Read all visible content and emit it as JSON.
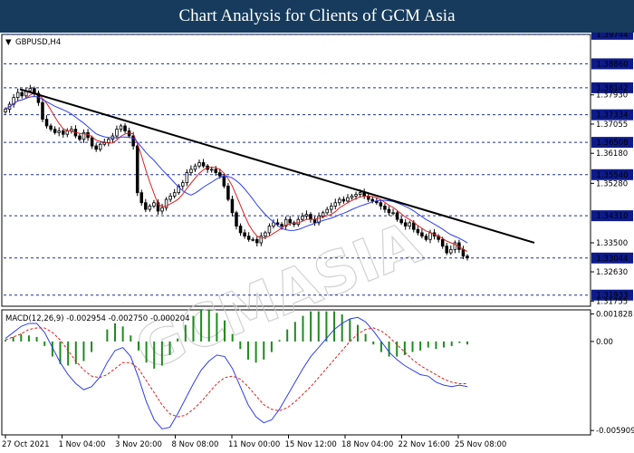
{
  "header": {
    "title": "Chart Analysis for Clients of GCM Asia"
  },
  "watermark": {
    "text": "GCMASIA"
  },
  "chart_data": [
    {
      "type": "candlestick",
      "symbol_label": "GBPUSD,H4",
      "ylim": [
        1.316,
        1.3974
      ],
      "y_tick_labels": [
        {
          "value": 1.3793,
          "label": "1.37930"
        },
        {
          "value": 1.37055,
          "label": "1.37055"
        },
        {
          "value": 1.3618,
          "label": "1.36180"
        },
        {
          "value": 1.3528,
          "label": "1.35280"
        },
        {
          "value": 1.335,
          "label": "1.33500"
        },
        {
          "value": 1.3263,
          "label": "1.32630"
        },
        {
          "value": 1.31755,
          "label": "1.31755"
        }
      ],
      "horizontal_levels": [
        {
          "value": 1.39744,
          "label": "1.39744"
        },
        {
          "value": 1.3886,
          "label": "1.38860"
        },
        {
          "value": 1.38142,
          "label": "1.38142"
        },
        {
          "value": 1.37334,
          "label": "1.37334"
        },
        {
          "value": 1.36508,
          "label": "1.36508"
        },
        {
          "value": 1.3554,
          "label": "1.35540"
        },
        {
          "value": 1.3431,
          "label": "1.34310"
        },
        {
          "value": 1.33044,
          "label": "1.33044"
        },
        {
          "value": 1.31933,
          "label": "1.31933"
        }
      ],
      "trendline": {
        "from": {
          "bar": 5,
          "price": 1.381
        },
        "to": {
          "bar": 146,
          "price": 1.335
        }
      },
      "close_prices": [
        1.375,
        1.3765,
        1.3785,
        1.38,
        1.379,
        1.3805,
        1.3812,
        1.3798,
        1.377,
        1.372,
        1.37,
        1.369,
        1.368,
        1.3685,
        1.3675,
        1.3685,
        1.369,
        1.367,
        1.366,
        1.368,
        1.3665,
        1.364,
        1.363,
        1.3645,
        1.365,
        1.366,
        1.367,
        1.369,
        1.37,
        1.3685,
        1.367,
        1.364,
        1.35,
        1.347,
        1.345,
        1.346,
        1.347,
        1.3445,
        1.3455,
        1.348,
        1.349,
        1.35,
        1.352,
        1.353,
        1.356,
        1.357,
        1.358,
        1.359,
        1.358,
        1.357,
        1.357,
        1.356,
        1.355,
        1.352,
        1.348,
        1.344,
        1.34,
        1.338,
        1.337,
        1.336,
        1.336,
        1.335,
        1.337,
        1.338,
        1.34,
        1.341,
        1.3405,
        1.34,
        1.342,
        1.341,
        1.3405,
        1.342,
        1.343,
        1.3435,
        1.342,
        1.341,
        1.343,
        1.344,
        1.345,
        1.346,
        1.347,
        1.348,
        1.3475,
        1.3485,
        1.349,
        1.3495,
        1.35,
        1.349,
        1.348,
        1.3475,
        1.347,
        1.346,
        1.345,
        1.344,
        1.344,
        1.342,
        1.341,
        1.34,
        1.341,
        1.339,
        1.338,
        1.337,
        1.336,
        1.338,
        1.337,
        1.336,
        1.334,
        1.332,
        1.333,
        1.335,
        1.333,
        1.331,
        1.3305
      ],
      "sma_fast_label": "red moving average",
      "sma_slow_label": "blue moving average",
      "x_tick_labels": [
        {
          "bar": 0,
          "label": "27 Oct 2021"
        },
        {
          "bar": 9,
          "label": "1 Nov 04:00"
        },
        {
          "bar": 18,
          "label": "3 Nov 20:00"
        },
        {
          "bar": 27,
          "label": "8 Nov 08:00"
        },
        {
          "bar": 36,
          "label": "11 Nov 00:00"
        },
        {
          "bar": 45,
          "label": "15 Nov 12:00"
        },
        {
          "bar": 54,
          "label": "18 Nov 04:00"
        },
        {
          "bar": 63,
          "label": "22 Nov 16:00"
        },
        {
          "bar": 72,
          "label": "25 Nov 08:00"
        }
      ]
    },
    {
      "type": "histogram+line",
      "indicator_label": "MACD(12,26,9) -0.002954 -0.002750 -0.000204",
      "ylim": [
        -0.0062,
        0.0021
      ],
      "y_tick_labels": [
        {
          "value": 0.001828,
          "label": "0.001828"
        },
        {
          "value": 0.0,
          "label": "0.00"
        },
        {
          "value": -0.005909,
          "label": "-0.005909"
        }
      ],
      "macd_line": [
        0.0002,
        0.0006,
        0.001,
        0.0012,
        0.0012,
        0.0006,
        -0.0004,
        -0.0014,
        -0.0022,
        -0.0028,
        -0.0032,
        -0.003,
        -0.0024,
        -0.0014,
        -0.0006,
        -0.0004,
        -0.001,
        -0.0024,
        -0.004,
        -0.0052,
        -0.0058,
        -0.0057,
        -0.0048,
        -0.0038,
        -0.0028,
        -0.0019,
        -0.0013,
        -0.0009,
        -0.001,
        -0.0018,
        -0.003,
        -0.0042,
        -0.005,
        -0.0054,
        -0.0052,
        -0.0045,
        -0.0036,
        -0.0027,
        -0.0018,
        -0.001,
        -0.0004,
        0.0002,
        0.0008,
        0.0012,
        0.0015,
        0.0016,
        0.0013,
        0.0007,
        0.0,
        -0.0007,
        -0.0012,
        -0.0016,
        -0.0019,
        -0.0022,
        -0.0023,
        -0.0027,
        -0.0029,
        -0.003,
        -0.0029,
        -0.003
      ],
      "signal_line": [
        0.0001,
        0.0003,
        0.0005,
        0.0008,
        0.0009,
        0.0009,
        0.0006,
        0.0001,
        -0.0006,
        -0.0013,
        -0.0019,
        -0.0023,
        -0.0024,
        -0.0022,
        -0.0018,
        -0.0014,
        -0.0014,
        -0.0018,
        -0.0026,
        -0.0034,
        -0.0042,
        -0.0048,
        -0.005,
        -0.0049,
        -0.0045,
        -0.004,
        -0.0034,
        -0.0028,
        -0.0024,
        -0.0023,
        -0.0025,
        -0.003,
        -0.0036,
        -0.0042,
        -0.0045,
        -0.0046,
        -0.0044,
        -0.004,
        -0.0035,
        -0.003,
        -0.0024,
        -0.0018,
        -0.0012,
        -0.0006,
        0.0,
        0.0005,
        0.0008,
        0.0009,
        0.0007,
        0.0003,
        -0.0002,
        -0.0007,
        -0.0012,
        -0.0016,
        -0.0019,
        -0.0022,
        -0.0025,
        -0.0027,
        -0.0028,
        -0.0028
      ],
      "histogram": [
        0.0001,
        0.0003,
        0.0005,
        0.0004,
        0.0003,
        -0.0003,
        -0.001,
        -0.0015,
        -0.0016,
        -0.0015,
        -0.0013,
        -0.0007,
        0.0,
        0.0008,
        0.0012,
        0.001,
        0.0004,
        -0.0006,
        -0.0014,
        -0.0018,
        -0.0016,
        -0.0009,
        0.0002,
        0.0011,
        0.0017,
        0.0021,
        0.0021,
        0.0019,
        0.0014,
        0.0005,
        -0.0005,
        -0.0012,
        -0.0014,
        -0.0012,
        -0.0007,
        0.0001,
        0.0008,
        0.0013,
        0.0017,
        0.002,
        0.002,
        0.002,
        0.002,
        0.0018,
        0.0015,
        0.0011,
        0.0005,
        -0.0002,
        -0.0007,
        -0.001,
        -0.001,
        -0.0009,
        -0.0007,
        -0.0006,
        -0.0004,
        -0.0005,
        -0.0004,
        -0.0003,
        -0.0001,
        -0.0002
      ]
    }
  ],
  "colors": {
    "header_bg": "#163b5c",
    "candle_up": "#ffffff",
    "candle_down": "#000000",
    "sma_fast": "#e02020",
    "sma_slow": "#2d3ff0",
    "trendline": "#000000",
    "level_line": "#1a2e9a",
    "label_box": "#0d1b8a",
    "macd_line": "#2d3ff0",
    "signal_line": "#e02020",
    "histogram": "#1e8a1e"
  }
}
